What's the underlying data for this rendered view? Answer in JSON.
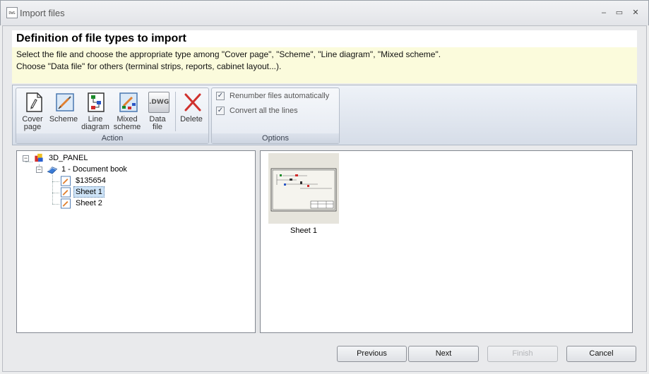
{
  "window": {
    "title": "Import files",
    "app_icon_text": "DWG",
    "controls": {
      "minimize": "–",
      "maximize": "▭",
      "close": "✕"
    }
  },
  "header": {
    "title": "Definition of file types to import",
    "description_lines": [
      "Select the file and choose the appropriate type among \"Cover page\", \"Scheme\", \"Line diagram\", \"Mixed scheme\".",
      "Choose \"Data file\" for others (terminal strips, reports, cabinet layout...)."
    ]
  },
  "ribbon": {
    "action_group": {
      "label": "Action",
      "buttons": [
        {
          "line1": "Cover",
          "line2": "page",
          "icon": "cover-page-icon"
        },
        {
          "line1": "Scheme",
          "line2": "",
          "icon": "scheme-icon"
        },
        {
          "line1": "Line",
          "line2": "diagram",
          "icon": "line-diagram-icon"
        },
        {
          "line1": "Mixed",
          "line2": "scheme",
          "icon": "mixed-scheme-icon"
        },
        {
          "line1": "Data",
          "line2": "file",
          "icon": "data-file-icon",
          "icon_text": ".DWG"
        },
        {
          "line1": "Delete",
          "line2": "",
          "icon": "delete-icon"
        }
      ]
    },
    "options_group": {
      "label": "Options",
      "checkboxes": [
        {
          "label": "Renumber files automatically",
          "checked": true
        },
        {
          "label": "Convert all the lines",
          "checked": true
        }
      ]
    }
  },
  "tree": {
    "root": {
      "label": "3D_PANEL",
      "expander": "−"
    },
    "book": {
      "label": "1 - Document book",
      "expander": "−"
    },
    "sheets": [
      {
        "label": "$135654",
        "selected": false
      },
      {
        "label": "Sheet 1",
        "selected": true
      },
      {
        "label": "Sheet 2",
        "selected": false
      }
    ]
  },
  "preview": {
    "items": [
      {
        "label": "Sheet 1"
      }
    ]
  },
  "footer": {
    "buttons": [
      {
        "label": "Previous",
        "enabled": true
      },
      {
        "label": "Next",
        "enabled": true
      },
      {
        "label": "Finish",
        "enabled": false
      },
      {
        "label": "Cancel",
        "enabled": true
      }
    ]
  },
  "colors": {
    "description_bg": "#fbfbdc",
    "selection_bg": "#cde3f7",
    "delete_red": "#d0312d"
  }
}
